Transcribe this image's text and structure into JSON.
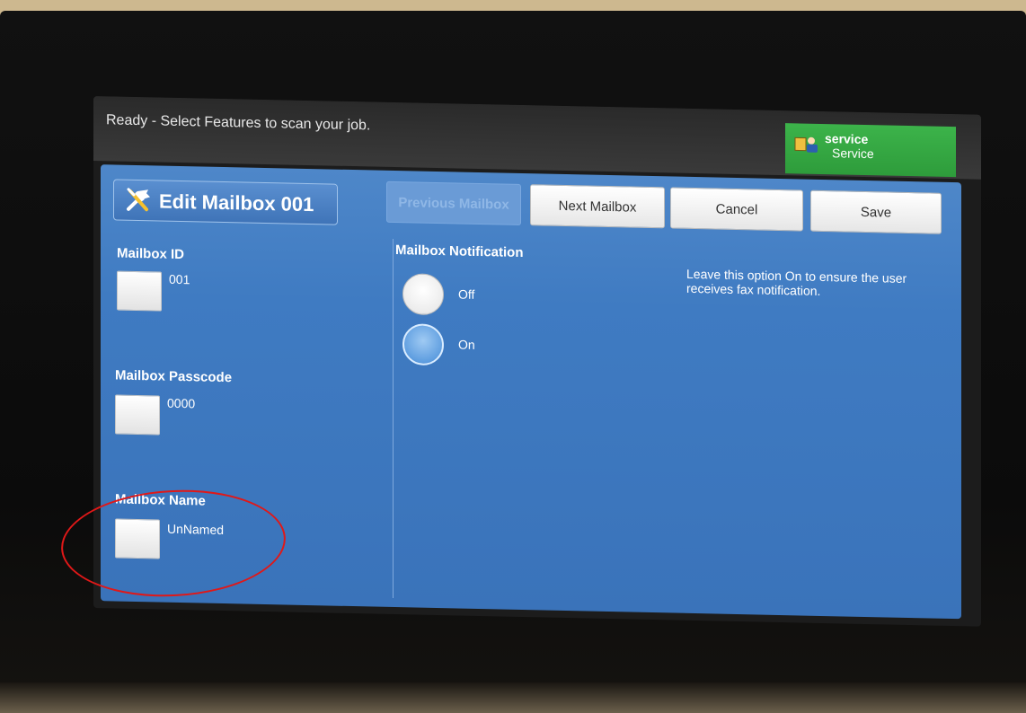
{
  "status_bar": {
    "message": "Ready -  Select Features to scan your job.",
    "service": {
      "title": "service",
      "subtitle": "Service",
      "icon": "user-service-icon",
      "color": "#38ae45"
    }
  },
  "header": {
    "title": "Edit Mailbox 001",
    "icon": "wrench-screwdriver-icon",
    "buttons": [
      {
        "label": "Previous Mailbox",
        "enabled": false
      },
      {
        "label": "Next Mailbox",
        "enabled": true
      },
      {
        "label": "Cancel",
        "enabled": true
      },
      {
        "label": "Save",
        "enabled": true
      }
    ]
  },
  "fields": {
    "mailbox_id": {
      "label": "Mailbox ID",
      "value": "001"
    },
    "mailbox_passcode": {
      "label": "Mailbox Passcode",
      "value": "0000"
    },
    "mailbox_name": {
      "label": "Mailbox Name",
      "value": "UnNamed"
    }
  },
  "notification": {
    "label": "Mailbox Notification",
    "options": [
      {
        "label": "Off",
        "selected": false
      },
      {
        "label": "On",
        "selected": true
      }
    ],
    "help": "Leave this option On to ensure the user receives fax notification."
  },
  "colors": {
    "panel": "#3f7bc2",
    "annotation": "#e01818"
  }
}
